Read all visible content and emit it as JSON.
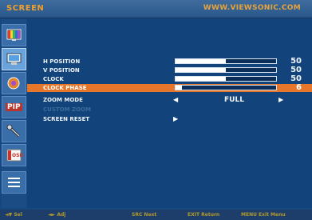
{
  "header": {
    "title": "SCREEN",
    "website": "WWW.VIEWSONIC.COM"
  },
  "sidebar": {
    "tabs": [
      {
        "name": "picture"
      },
      {
        "name": "screen",
        "active": true
      },
      {
        "name": "audio"
      },
      {
        "name": "pip",
        "label": "PIP"
      },
      {
        "name": "setup"
      },
      {
        "name": "osd",
        "label": "OSD"
      },
      {
        "name": "menu"
      }
    ]
  },
  "menu": {
    "h_position": {
      "label": "H POSITION",
      "value": "50",
      "level": 0.5
    },
    "v_position": {
      "label": "V POSITION",
      "value": "50",
      "level": 0.5
    },
    "clock": {
      "label": "CLOCK",
      "value": "50",
      "level": 0.5
    },
    "clock_phase": {
      "label": "CLOCK PHASE",
      "value": "6",
      "level": 0.06
    },
    "zoom_mode": {
      "label": "ZOOM MODE",
      "value": "FULL"
    },
    "custom_zoom": {
      "label": "CUSTOM ZOOM"
    },
    "screen_reset": {
      "label": "SCREEN RESET"
    }
  },
  "footer": {
    "sel": "◄▼ Sel",
    "adj": "◄► Adj",
    "next": "SRC Next",
    "ret": "EXIT Return",
    "exit_menu": "MENU Exit Menu"
  },
  "colors": {
    "highlight": "#e6762a",
    "header_text": "#f2a02b",
    "background": "#16477f"
  }
}
